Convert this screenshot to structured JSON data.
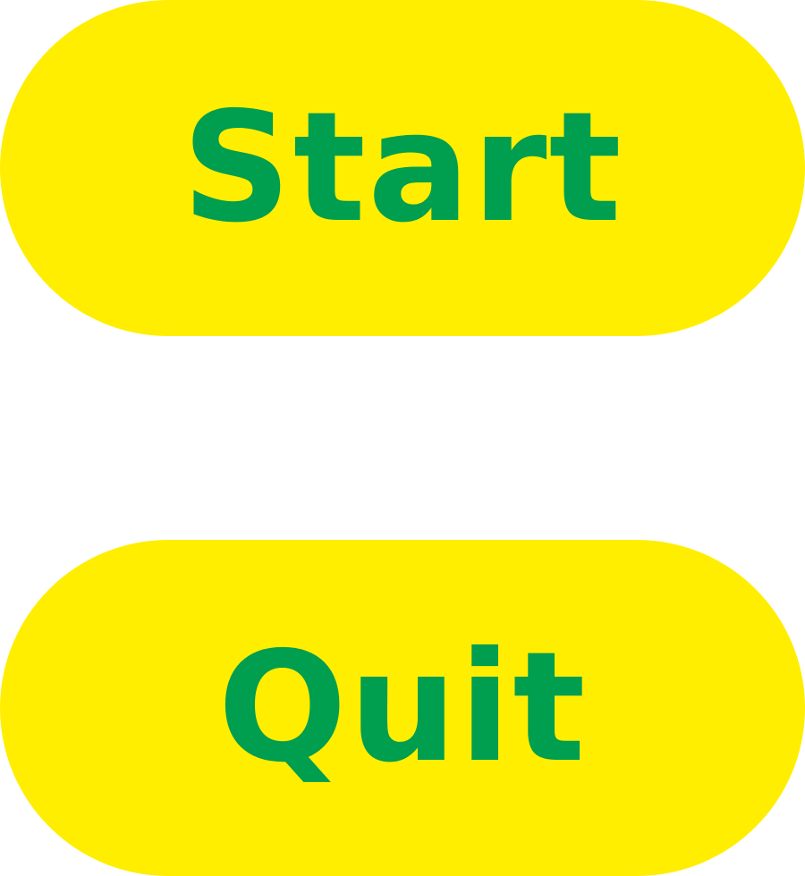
{
  "colors": {
    "button_fill": "#FFEE00",
    "label_color": "#009E4F",
    "background": "#FFFFFF"
  },
  "menu": {
    "start_label": "Start",
    "quit_label": "Quit"
  }
}
